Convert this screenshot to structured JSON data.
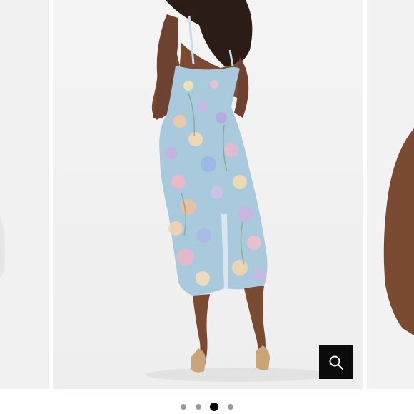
{
  "carousel": {
    "slides": [
      {
        "name": "previous-slide-dress-photo"
      },
      {
        "name": "current-slide-floral-midi-dress-back-view"
      },
      {
        "name": "next-slide-arm-closeup"
      }
    ],
    "zoom_button": {
      "icon": "magnifier-icon"
    },
    "pagination": {
      "count": 4,
      "active_index": 2
    }
  },
  "colors": {
    "dress": "#a9c9dd",
    "skin": "#7a4a33",
    "hair": "#2b1d16",
    "heels": "#c9a37a",
    "zoom_bg": "#0b0b0b",
    "dot_inactive": "#9a9a9a",
    "dot_active": "#0a0a0a"
  }
}
